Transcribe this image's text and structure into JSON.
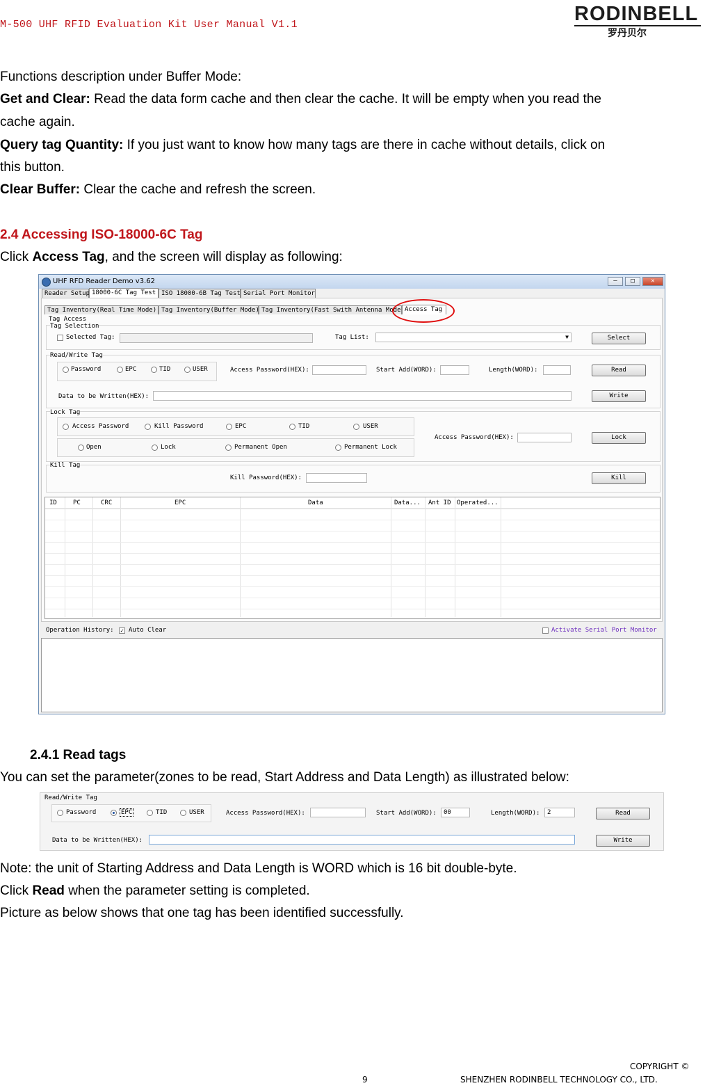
{
  "header": {
    "manual_title": "M-500 UHF RFID Evaluation Kit User Manual V1.1",
    "logo_text": "RODINBELL",
    "logo_sub": "罗丹贝尔"
  },
  "body": {
    "functions_intro": "Functions description under Buffer Mode:",
    "get_clear_label": "Get and Clear:",
    "get_clear_text": " Read the data form cache and then clear the cache. It will be empty when you read the",
    "get_clear_text2": "cache again.",
    "query_label": "Query tag Quantity:",
    "query_text": " If you just want to know how many tags are there in cache without details, click on",
    "query_text2": "this button.",
    "clear_label": "Clear Buffer:",
    "clear_text": " Clear the cache and refresh the screen.",
    "section_title": "2.4 Accessing ISO-18000-6C Tag",
    "click_pre": "Click ",
    "click_bold": "Access Tag",
    "click_post": ", and the screen will display as following:",
    "subsection_title": "2.4.1 Read tags",
    "param_text": "You can set the parameter(zones to be read, Start Address and Data Length) as illustrated below:",
    "note_text": "Note: the unit of Starting Address and Data Length is WORD which is 16 bit double-byte.",
    "click_read_pre": "Click ",
    "click_read_bold": "Read",
    "click_read_post": " when the parameter setting is completed.",
    "picture_text": "Picture as below shows that one tag has been identified successfully."
  },
  "window": {
    "title": "UHF RFD Reader Demo v3.62",
    "main_tabs": [
      "Reader Setup",
      "18000-6C Tag Test",
      "ISO 18000-6B Tag Test",
      "Serial Port Monitor"
    ],
    "sub_tabs": [
      "Tag Inventory(Real Time Mode)",
      "Tag Inventory(Buffer Mode)",
      "Tag Inventory(Fast Swith Antenna Mode)",
      "Access Tag"
    ],
    "tag_access": "Tag Access",
    "tag_selection": "Tag Selection",
    "selected_tag": "Selected Tag:",
    "tag_list": "Tag List:",
    "select_btn": "Select",
    "rw_group": "Read/Write Tag",
    "rw_options": [
      "Password",
      "EPC",
      "TID",
      "USER"
    ],
    "access_pwd": "Access Password(HEX):",
    "start_add": "Start Add(WORD):",
    "length": "Length(WORD):",
    "read_btn": "Read",
    "data_written": "Data to be Written(HEX):",
    "write_btn": "Write",
    "lock_group": "Lock Tag",
    "lock_targets": [
      "Access Password",
      "Kill Password",
      "EPC",
      "TID",
      "USER"
    ],
    "lock_modes": [
      "Open",
      "Lock",
      "Permanent Open",
      "Permanent Lock"
    ],
    "lock_btn": "Lock",
    "kill_group": "Kill Tag",
    "kill_pwd": "Kill Password(HEX):",
    "kill_btn": "Kill",
    "columns": [
      "ID",
      "PC",
      "CRC",
      "EPC",
      "Data",
      "Data...",
      "Ant ID",
      "Operated..."
    ],
    "op_history": "Operation History:",
    "auto_clear": "Auto Clear",
    "activate_monitor": "Activate Serial Port Monitor",
    "min_icon": "minimize-icon",
    "max_icon": "maximize-icon",
    "close_icon": "close-icon"
  },
  "rw_panel": {
    "group": "Read/Write Tag",
    "options": [
      "Password",
      "EPC",
      "TID",
      "USER"
    ],
    "selected": "EPC",
    "access_pwd": "Access Password(HEX):",
    "start_add": "Start Add(WORD):",
    "start_value": "00",
    "length": "Length(WORD):",
    "length_value": "2",
    "read_btn": "Read",
    "data_written": "Data to be Written(HEX):",
    "write_btn": "Write"
  },
  "footer": {
    "copyright": "COPYRIGHT ©",
    "page_number": "9",
    "company": "SHENZHEN RODINBELL TECHNOLOGY CO., LTD."
  },
  "colors": {
    "heading_red": "#c0161b",
    "annotation_red": "#e01010"
  }
}
